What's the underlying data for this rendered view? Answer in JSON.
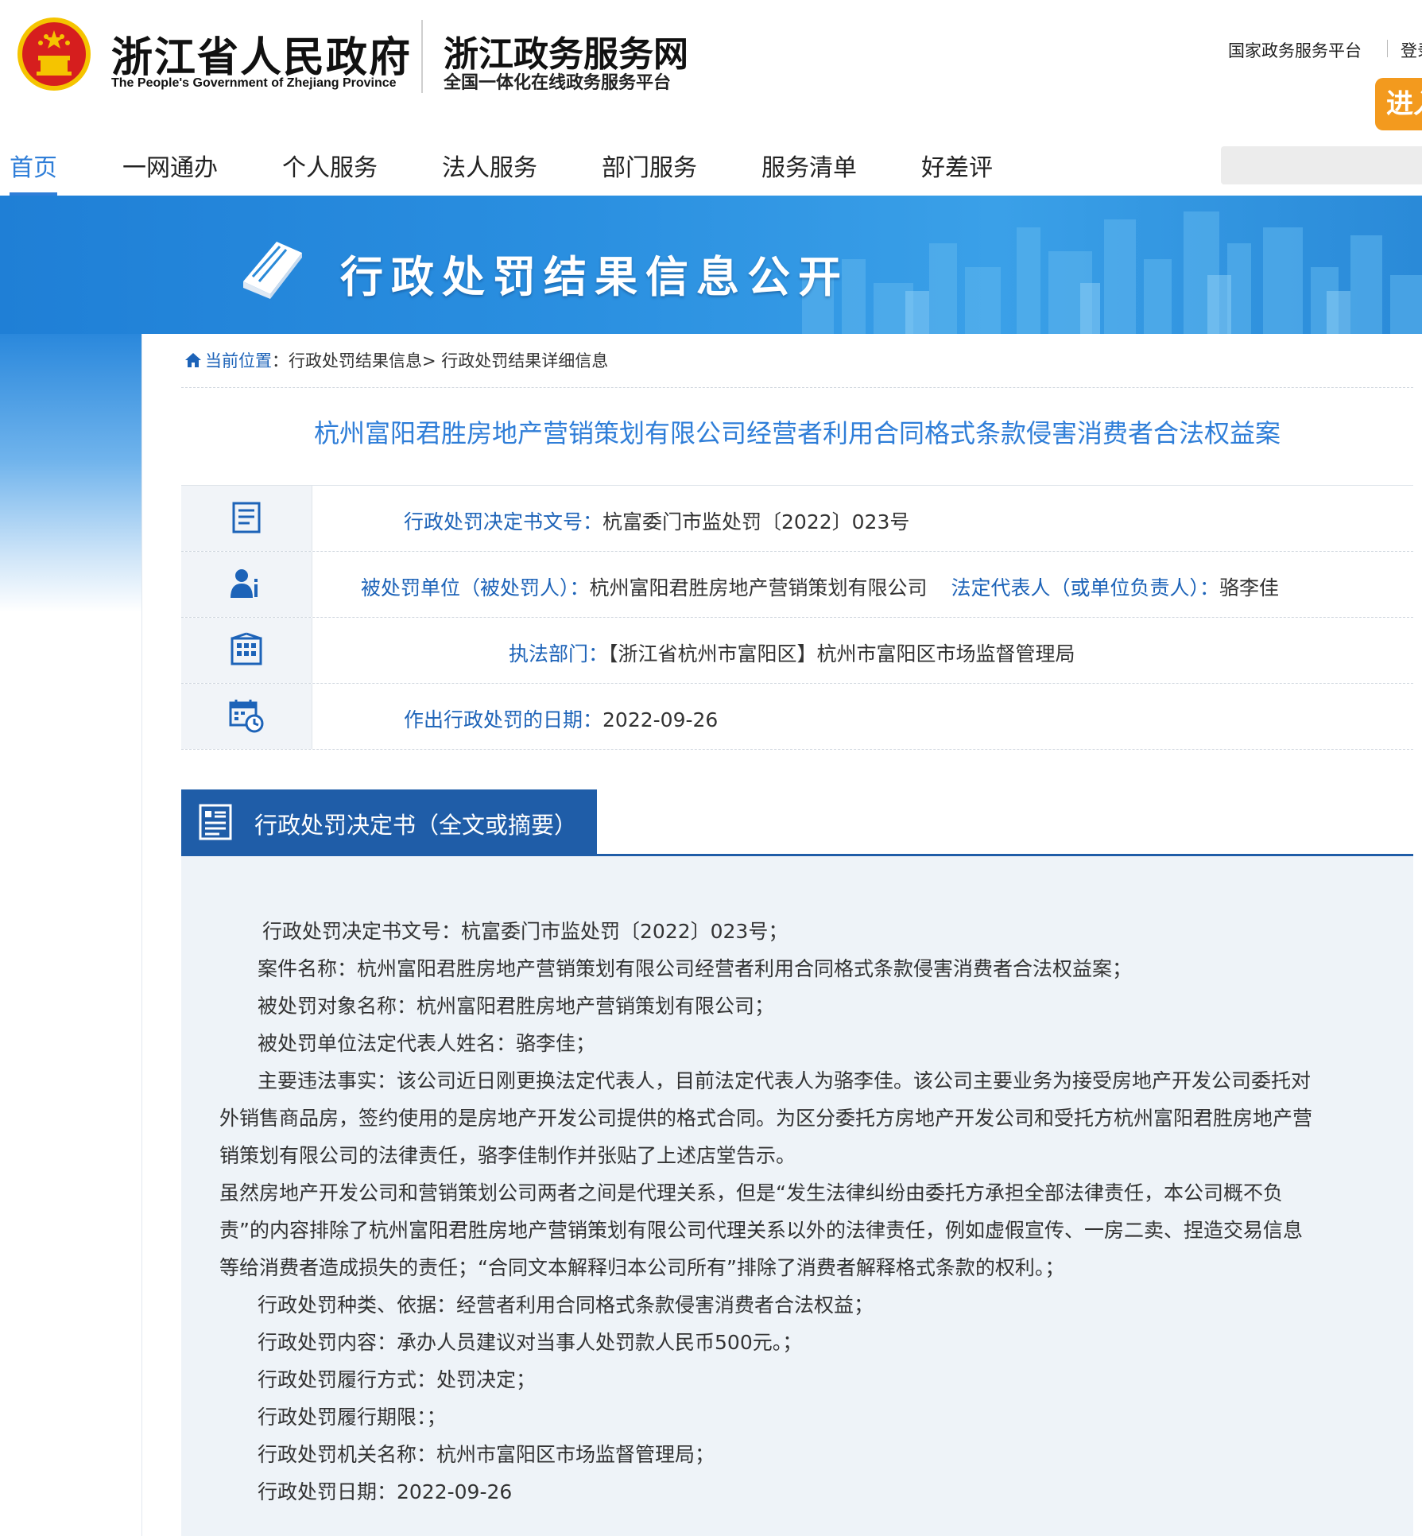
{
  "header": {
    "gov_title": "浙江省人民政府",
    "gov_title_en": "The People's Government of Zhejiang Province",
    "portal_title": "浙江政务服务网",
    "portal_subtitle": "全国一体化在线政务服务平台",
    "top_links": [
      "国家政务服务平台",
      "登录"
    ],
    "enter_label": "进入"
  },
  "nav": {
    "items": [
      "首页",
      "一网通办",
      "个人服务",
      "法人服务",
      "部门服务",
      "服务清单",
      "好差评"
    ],
    "active": "首页"
  },
  "banner": {
    "title": "行政处罚结果信息公开"
  },
  "breadcrumb": {
    "home": "当前位置",
    "sep": "：",
    "level1": "行政处罚结果信息",
    "arrow": "> ",
    "level2": "行政处罚结果详细信息"
  },
  "case_title": "杭州富阳君胜房地产营销策划有限公司经营者利用合同格式条款侵害消费者合法权益案",
  "info": {
    "decision_no_label": "行政处罚决定书文号：",
    "decision_no": "杭富委门市监处罚〔2022〕023号",
    "party_label": "被处罚单位（被处罚人）：",
    "party": "杭州富阳君胜房地产营销策划有限公司",
    "rep_label": "法定代表人（或单位负责人）：",
    "rep": "骆李佳",
    "dept_label": "执法部门：",
    "dept": "【浙江省杭州市富阳区】杭州市富阳区市场监督管理局",
    "date_label": "作出行政处罚的日期：",
    "date": "2022-09-26"
  },
  "section": {
    "title": "行政处罚决定书（全文或摘要）"
  },
  "document": {
    "lines": [
      "行政处罚决定书文号：杭富委门市监处罚〔2022〕023号；",
      "案件名称：杭州富阳君胜房地产营销策划有限公司经营者利用合同格式条款侵害消费者合法权益案；",
      "被处罚对象名称：杭州富阳君胜房地产营销策划有限公司；",
      "被处罚单位法定代表人姓名：骆李佳；",
      "主要违法事实：该公司近日刚更换法定代表人，目前法定代表人为骆李佳。该公司主要业务为接受房地产开发公司委托对",
      "外销售商品房，签约使用的是房地产开发公司提供的格式合同。为区分委托方房地产开发公司和受托方杭州富阳君胜房地产营",
      "销策划有限公司的法律责任，骆李佳制作并张贴了上述店堂告示。",
      "虽然房地产开发公司和营销策划公司两者之间是代理关系，但是“发生法律纠纷由委托方承担全部法律责任，本公司概不负",
      "责”的内容排除了杭州富阳君胜房地产营销策划有限公司代理关系以外的法律责任，例如虚假宣传、一房二卖、捏造交易信息",
      "等给消费者造成损失的责任；“合同文本解释归本公司所有”排除了消费者解释格式条款的权利。；",
      "行政处罚种类、依据：经营者利用合同格式条款侵害消费者合法权益；",
      "行政处罚内容：承办人员建议对当事人处罚款人民币500元。；",
      "行政处罚履行方式：处罚决定；",
      "行政处罚履行期限：；",
      "行政处罚机关名称：杭州市富阳区市场监督管理局；",
      "行政处罚日期：2022-09-26"
    ]
  },
  "colors": {
    "link_blue": "#2f7ed8",
    "label_blue": "#1d63b8",
    "tab_blue": "#1f5da8",
    "enter_orange": "#f39a1e"
  }
}
